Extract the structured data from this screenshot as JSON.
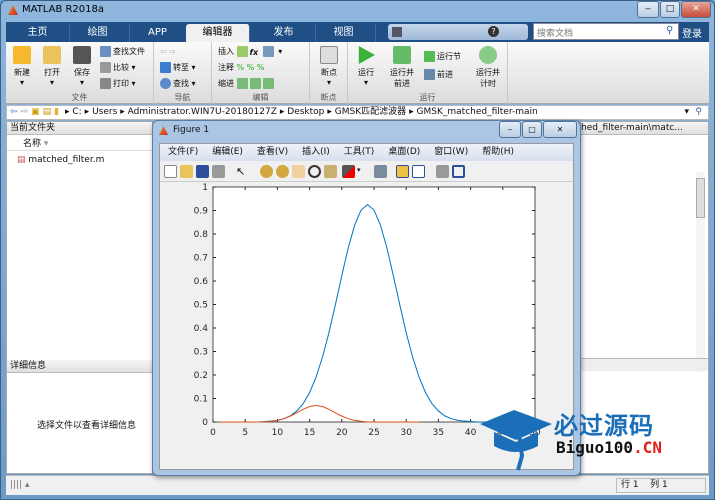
{
  "window": {
    "title": "MATLAB R2018a",
    "min": "‒",
    "max": "□",
    "close": "✕"
  },
  "tabs": [
    {
      "label": "主页"
    },
    {
      "label": "绘图"
    },
    {
      "label": "APP"
    },
    {
      "label": "编辑器",
      "active": true
    },
    {
      "label": "发布"
    },
    {
      "label": "视图"
    }
  ],
  "search": {
    "placeholder": "搜索文档",
    "icon": "search-icon"
  },
  "login": "登录",
  "ribbon": {
    "file": {
      "label": "文件",
      "new": "新建",
      "open": "打开",
      "save": "保存",
      "find_files": "查找文件",
      "compare": "比较",
      "print": "打印"
    },
    "nav": {
      "label": "导航",
      "goto": "转至",
      "find": "查找"
    },
    "edit": {
      "label": "编辑",
      "insert": "插入",
      "comment": "注释",
      "indent": "缩进",
      "fx": "fx"
    },
    "breakpoints": {
      "label": "断点",
      "breakpoints": "断点"
    },
    "run": {
      "label": "运行",
      "run": "运行",
      "run_advance": "运行并\n前进",
      "run_section": "运行节",
      "advance": "前进",
      "run_time": "运行并\n计时"
    }
  },
  "address": [
    "C:",
    "Users",
    "Administrator.WIN7U-20180127Z",
    "Desktop",
    "GMSK匹配滤波器",
    "GMSK_matched_filter-main"
  ],
  "current_folder": {
    "title": "当前文件夹",
    "col_name": "名称",
    "files": [
      "matched_filter.m"
    ]
  },
  "details": {
    "title": "详细信息",
    "message": "选择文件以查看详细信息"
  },
  "editor": {
    "title": "hed_filter-main\\matc..."
  },
  "status": {
    "row_label": "行",
    "row": "1",
    "col_label": "列",
    "col": "1"
  },
  "figure": {
    "title": "Figure 1",
    "menu": [
      "文件(F)",
      "编辑(E)",
      "查看(V)",
      "插入(I)",
      "工具(T)",
      "桌面(D)",
      "窗口(W)",
      "帮助(H)"
    ]
  },
  "watermark": {
    "cn": "必过源码",
    "en": "Biguo100",
    "tld": ".CN"
  },
  "colors": {
    "series1": "#0072bd",
    "series2": "#d95319",
    "ribbon_tab": "#1f4f84"
  },
  "chart_data": {
    "type": "line",
    "xlim": [
      0,
      50
    ],
    "ylim": [
      0,
      1
    ],
    "xticks": [
      0,
      5,
      10,
      15,
      20,
      25,
      30,
      35,
      40,
      45,
      50
    ],
    "yticks": [
      0,
      0.1,
      0.2,
      0.3,
      0.4,
      0.5,
      0.6,
      0.7,
      0.8,
      0.9,
      1
    ],
    "grid": false,
    "series": [
      {
        "x": [
          1,
          2,
          3,
          4,
          5,
          6,
          7,
          8,
          9,
          10,
          11,
          12,
          13,
          14,
          15,
          16,
          17,
          18,
          19,
          20,
          21,
          22,
          23,
          24,
          25,
          26,
          27,
          28,
          29,
          30,
          31,
          32,
          33,
          34,
          35,
          36,
          37,
          38,
          39,
          40,
          41,
          42,
          43,
          44,
          45,
          46,
          47,
          48,
          49,
          50
        ],
        "y": [
          0,
          0,
          0,
          0,
          0,
          0,
          0,
          0.002,
          0.004,
          0.007,
          0.014,
          0.026,
          0.047,
          0.078,
          0.125,
          0.191,
          0.276,
          0.38,
          0.499,
          0.623,
          0.741,
          0.838,
          0.902,
          0.925,
          0.902,
          0.838,
          0.741,
          0.623,
          0.499,
          0.38,
          0.276,
          0.191,
          0.125,
          0.078,
          0.047,
          0.026,
          0.014,
          0.007,
          0.004,
          0.002,
          0,
          0,
          0,
          0,
          0,
          0,
          0,
          0,
          0,
          0
        ],
        "color": "#0072bd"
      },
      {
        "x": [
          1,
          2,
          3,
          4,
          5,
          6,
          7,
          8,
          9,
          10,
          11,
          12,
          13,
          14,
          15,
          16,
          17,
          18,
          19,
          20,
          21,
          22,
          23,
          24,
          25,
          26,
          27,
          28,
          29,
          30,
          31,
          32
        ],
        "y": [
          0,
          0,
          0,
          0,
          0,
          0,
          0,
          0,
          0.003,
          0.007,
          0.014,
          0.025,
          0.039,
          0.054,
          0.066,
          0.07,
          0.066,
          0.054,
          0.039,
          0.025,
          0.014,
          0.007,
          0.003,
          0,
          0,
          0,
          0,
          0,
          0,
          0,
          0,
          0
        ],
        "color": "#d95319"
      }
    ]
  }
}
